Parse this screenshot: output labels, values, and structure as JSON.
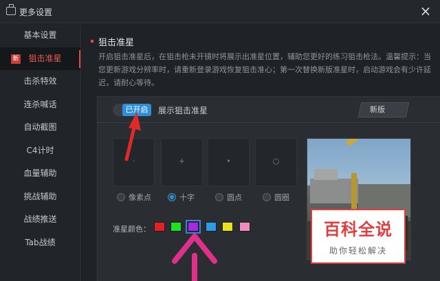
{
  "window": {
    "title": "更多设置",
    "close_label": "×"
  },
  "sidebar": {
    "items": [
      {
        "label": "基本设置",
        "active": false
      },
      {
        "label": "狙击准星",
        "active": true,
        "badge": "新"
      },
      {
        "label": "击杀特效",
        "active": false
      },
      {
        "label": "连杀喊话",
        "active": false
      },
      {
        "label": "自动截图",
        "active": false
      },
      {
        "label": "C4计时",
        "active": false
      },
      {
        "label": "血量辅助",
        "active": false
      },
      {
        "label": "挑战辅助",
        "active": false
      },
      {
        "label": "战绩推送",
        "active": false
      },
      {
        "label": "Tab战绩",
        "active": false
      }
    ]
  },
  "main": {
    "section_title": "狙击准星",
    "description": "开启狙击准星后，在狙击枪未开镜时将展示出准星位置，辅助您更好的练习狙击枪法。温馨提示：当您更新游戏分辨率时，请重新登录游戏恢复狙击准心；第一次替换新版准星时，启动游戏会有少许延迟，请耐心等待。",
    "toggle_state": "已开启",
    "toggle_label": "展示狙击准星",
    "version_button": "新版",
    "crosshair_options": [
      {
        "label": "像素点",
        "glyph": "·",
        "checked": false
      },
      {
        "label": "十字",
        "glyph": "+",
        "checked": true
      },
      {
        "label": "圆点",
        "glyph": "•",
        "checked": false
      },
      {
        "label": "圆圈",
        "glyph": "○",
        "checked": false
      }
    ],
    "color_label": "准星颜色：",
    "colors": [
      "#e02222",
      "#22e022",
      "#a02ee0",
      "#2e9ae8",
      "#e8e020",
      "#f28cc0"
    ],
    "selected_color_index": 2
  },
  "watermark": {
    "title": "百科全说",
    "subtitle": "助你轻松解决",
    "color": "#e33c3c"
  },
  "accent": {
    "active": "#e85a4f",
    "toggle": "#2e8fd8",
    "annotation_red": "#e02a2a",
    "annotation_pink": "#e0308a"
  }
}
